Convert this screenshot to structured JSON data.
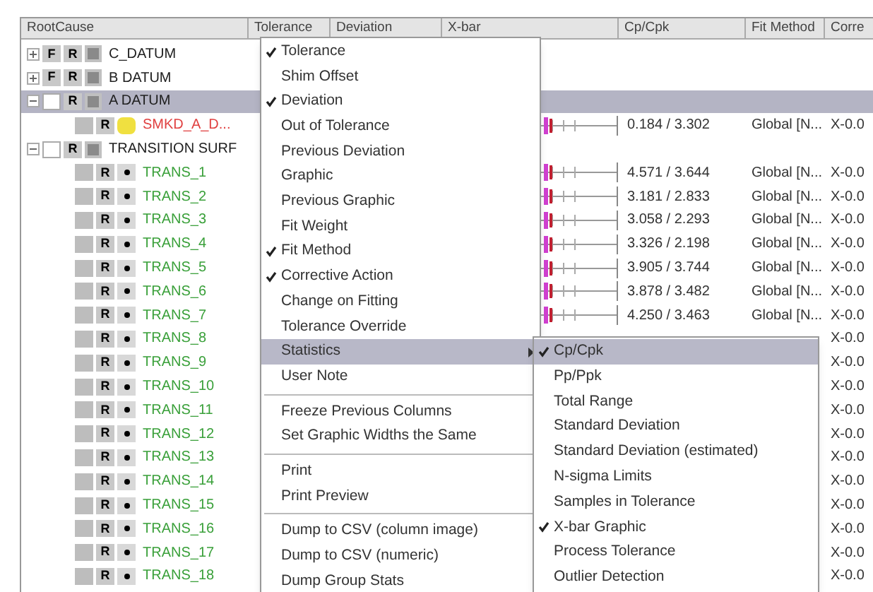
{
  "table": {
    "columns": [
      "RootCause",
      "Tolerance",
      "Deviation",
      "X-bar",
      "Cp/Cpk",
      "Fit Method",
      "Corre"
    ],
    "rows": [
      {
        "name": "C_DATUM",
        "f_label": "F",
        "r_label": "R",
        "expanded": false,
        "selected": false,
        "color": "#202020"
      },
      {
        "name": "B DATUM",
        "f_label": "F",
        "r_label": "R",
        "expanded": false,
        "selected": false,
        "color": "#202020"
      },
      {
        "name": "A DATUM",
        "r_label": "R",
        "expanded": true,
        "selected": true,
        "color": "#202020",
        "children": [
          {
            "name": "SMKD_A_D...",
            "kind": "feature",
            "r_label": "R",
            "selected": false,
            "color": "#e04040",
            "cp_cpk": "0.184 / 3.302",
            "fit_method": "Global [N...",
            "corrective": "X-0.0"
          }
        ]
      },
      {
        "name": "TRANSITION SURF",
        "r_label": "R",
        "expanded": true,
        "selected": false,
        "color": "#202020",
        "children": [
          {
            "name": "TRANS_1",
            "kind": "point",
            "r_label": "R",
            "selected": false,
            "color": "#3aa03a",
            "cp_cpk": "4.571 / 3.644",
            "fit_method": "Global [N...",
            "corrective": "X-0.0"
          },
          {
            "name": "TRANS_2",
            "kind": "point",
            "r_label": "R",
            "selected": false,
            "color": "#3aa03a",
            "cp_cpk": "3.181 / 2.833",
            "fit_method": "Global [N...",
            "corrective": "X-0.0"
          },
          {
            "name": "TRANS_3",
            "kind": "point",
            "r_label": "R",
            "selected": false,
            "color": "#3aa03a",
            "cp_cpk": "3.058 / 2.293",
            "fit_method": "Global [N...",
            "corrective": "X-0.0"
          },
          {
            "name": "TRANS_4",
            "kind": "point",
            "r_label": "R",
            "selected": false,
            "color": "#3aa03a",
            "cp_cpk": "3.326 / 2.198",
            "fit_method": "Global [N...",
            "corrective": "X-0.0"
          },
          {
            "name": "TRANS_5",
            "kind": "point",
            "r_label": "R",
            "selected": false,
            "color": "#3aa03a",
            "cp_cpk": "3.905 / 3.744",
            "fit_method": "Global [N...",
            "corrective": "X-0.0"
          },
          {
            "name": "TRANS_6",
            "kind": "point",
            "r_label": "R",
            "selected": false,
            "color": "#3aa03a",
            "cp_cpk": "3.878 / 3.482",
            "fit_method": "Global [N...",
            "corrective": "X-0.0"
          },
          {
            "name": "TRANS_7",
            "kind": "point",
            "r_label": "R",
            "selected": false,
            "color": "#3aa03a",
            "cp_cpk": "4.250 / 3.463",
            "fit_method": "Global [N...",
            "corrective": "X-0.0"
          },
          {
            "name": "TRANS_8",
            "kind": "point",
            "r_label": "R",
            "selected": false,
            "color": "#3aa03a",
            "corrective": "X-0.0"
          },
          {
            "name": "TRANS_9",
            "kind": "point",
            "r_label": "R",
            "selected": false,
            "color": "#3aa03a",
            "corrective": "X-0.0"
          },
          {
            "name": "TRANS_10",
            "kind": "point",
            "r_label": "R",
            "selected": false,
            "color": "#3aa03a",
            "corrective": "X-0.0"
          },
          {
            "name": "TRANS_11",
            "kind": "point",
            "r_label": "R",
            "selected": false,
            "color": "#3aa03a",
            "corrective": "X-0.0"
          },
          {
            "name": "TRANS_12",
            "kind": "point",
            "r_label": "R",
            "selected": false,
            "color": "#3aa03a",
            "corrective": "X-0.0"
          },
          {
            "name": "TRANS_13",
            "kind": "point",
            "r_label": "R",
            "selected": false,
            "color": "#3aa03a",
            "corrective": "X-0.0"
          },
          {
            "name": "TRANS_14",
            "kind": "point",
            "r_label": "R",
            "selected": false,
            "color": "#3aa03a",
            "corrective": "X-0.0"
          },
          {
            "name": "TRANS_15",
            "kind": "point",
            "r_label": "R",
            "selected": false,
            "color": "#3aa03a",
            "corrective": "X-0.0"
          },
          {
            "name": "TRANS_16",
            "kind": "point",
            "r_label": "R",
            "selected": false,
            "color": "#3aa03a",
            "corrective": "X-0.0"
          },
          {
            "name": "TRANS_17",
            "kind": "point",
            "r_label": "R",
            "selected": false,
            "color": "#3aa03a",
            "corrective": "X-0.0"
          },
          {
            "name": "TRANS_18",
            "kind": "point",
            "r_label": "R",
            "selected": false,
            "color": "#3aa03a",
            "corrective": "X-0.0"
          }
        ]
      }
    ]
  },
  "context_menu": {
    "items": [
      {
        "kind": "item",
        "label": "Tolerance",
        "checked": true,
        "selected": false
      },
      {
        "kind": "item",
        "label": "Shim Offset",
        "checked": false,
        "selected": false
      },
      {
        "kind": "item",
        "label": "Deviation",
        "checked": true,
        "selected": false
      },
      {
        "kind": "item",
        "label": "Out of Tolerance",
        "checked": false,
        "selected": false
      },
      {
        "kind": "item",
        "label": "Previous Deviation",
        "checked": false,
        "selected": false
      },
      {
        "kind": "item",
        "label": "Graphic",
        "checked": false,
        "selected": false
      },
      {
        "kind": "item",
        "label": "Previous Graphic",
        "checked": false,
        "selected": false
      },
      {
        "kind": "item",
        "label": "Fit Weight",
        "checked": false,
        "selected": false
      },
      {
        "kind": "item",
        "label": "Fit Method",
        "checked": true,
        "selected": false
      },
      {
        "kind": "item",
        "label": "Corrective Action",
        "checked": true,
        "selected": false
      },
      {
        "kind": "item",
        "label": "Change on Fitting",
        "checked": false,
        "selected": false
      },
      {
        "kind": "item",
        "label": "Tolerance Override",
        "checked": false,
        "selected": false
      },
      {
        "kind": "submenu",
        "label": "Statistics",
        "checked": false,
        "selected": true
      },
      {
        "kind": "item",
        "label": "User Note",
        "checked": false,
        "selected": false
      },
      {
        "kind": "separator"
      },
      {
        "kind": "item",
        "label": "Freeze Previous Columns",
        "checked": false,
        "selected": false
      },
      {
        "kind": "item",
        "label": "Set Graphic Widths the Same",
        "checked": false,
        "selected": false
      },
      {
        "kind": "separator"
      },
      {
        "kind": "item",
        "label": "Print",
        "checked": false,
        "selected": false
      },
      {
        "kind": "item",
        "label": "Print Preview",
        "checked": false,
        "selected": false
      },
      {
        "kind": "separator"
      },
      {
        "kind": "item",
        "label": "Dump to CSV (column image)",
        "checked": false,
        "selected": false
      },
      {
        "kind": "item",
        "label": "Dump to CSV (numeric)",
        "checked": false,
        "selected": false
      },
      {
        "kind": "item",
        "label": "Dump Group Stats",
        "checked": false,
        "selected": false
      }
    ]
  },
  "statistics_submenu": {
    "items": [
      {
        "label": "Cp/Cpk",
        "checked": true,
        "selected": true
      },
      {
        "label": "Pp/Ppk",
        "checked": false,
        "selected": false
      },
      {
        "label": "Total Range",
        "checked": false,
        "selected": false
      },
      {
        "label": "Standard Deviation",
        "checked": false,
        "selected": false
      },
      {
        "label": "Standard Deviation (estimated)",
        "checked": false,
        "selected": false
      },
      {
        "label": "N-sigma Limits",
        "checked": false,
        "selected": false
      },
      {
        "label": "Samples in Tolerance",
        "checked": false,
        "selected": false
      },
      {
        "label": "X-bar Graphic",
        "checked": true,
        "selected": false
      },
      {
        "label": "Process Tolerance",
        "checked": false,
        "selected": false
      },
      {
        "label": "Outlier Detection",
        "checked": false,
        "selected": false
      }
    ]
  }
}
